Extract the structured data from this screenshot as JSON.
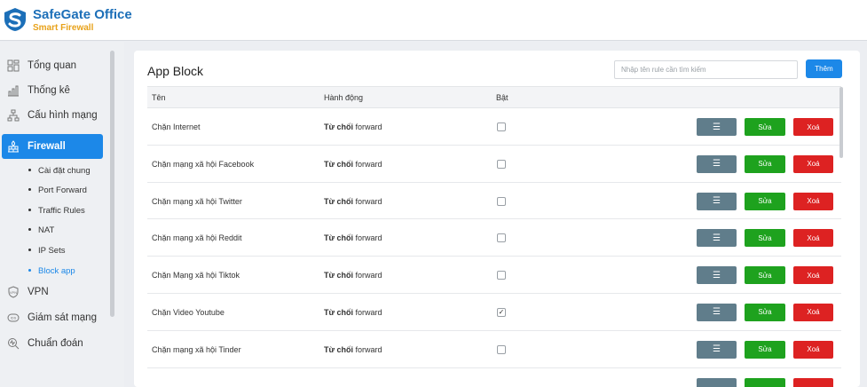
{
  "brand": {
    "title": "SafeGate Office",
    "subtitle": "Smart Firewall"
  },
  "sidebar": {
    "items": [
      {
        "label": "Tổng quan",
        "icon": "dashboard-icon"
      },
      {
        "label": "Thống kê",
        "icon": "chart-icon"
      },
      {
        "label": "Cấu hình mạng",
        "icon": "network-icon"
      },
      {
        "label": "Firewall",
        "icon": "firewall-icon",
        "active": true
      },
      {
        "label": "VPN",
        "icon": "vpn-shield-icon"
      },
      {
        "label": "Giám sát mạng",
        "icon": "ids-icon"
      },
      {
        "label": "Chuẩn đoán",
        "icon": "diagnostics-icon"
      }
    ],
    "subitems": [
      {
        "label": "Cài đặt chung"
      },
      {
        "label": "Port Forward"
      },
      {
        "label": "Traffic Rules"
      },
      {
        "label": "NAT"
      },
      {
        "label": "IP Sets"
      },
      {
        "label": "Block app",
        "active": true
      }
    ]
  },
  "main": {
    "title": "App Block",
    "search_placeholder": "Nhập tên rule cần tìm kiếm",
    "add_label": "Thêm",
    "columns": [
      "Tên",
      "Hành động",
      "Bật"
    ],
    "rows": [
      {
        "name": "Chặn Internet",
        "action_bold": "Từ chối",
        "action_rest": " forward",
        "enabled": false
      },
      {
        "name": "Chặn mạng xã hội Facebook",
        "action_bold": "Từ chối",
        "action_rest": " forward",
        "enabled": false
      },
      {
        "name": "Chặn mạng xã hội Twitter",
        "action_bold": "Từ chối",
        "action_rest": " forward",
        "enabled": false
      },
      {
        "name": "Chặn mạng xã hội Reddit",
        "action_bold": "Từ chối",
        "action_rest": " forward",
        "enabled": false
      },
      {
        "name": "Chặn Mạng xã hội Tiktok",
        "action_bold": "Từ chối",
        "action_rest": " forward",
        "enabled": false
      },
      {
        "name": "Chặn Video Youtube",
        "action_bold": "Từ chối",
        "action_rest": " forward",
        "enabled": true
      },
      {
        "name": "Chặn mạng xã hội Tinder",
        "action_bold": "Từ chối",
        "action_rest": " forward",
        "enabled": false
      }
    ],
    "row_buttons": {
      "menu": "☰",
      "edit": "Sửa",
      "delete": "Xoá"
    }
  },
  "colors": {
    "primary": "#1c88e8",
    "brand_blue": "#1c6fb8",
    "brand_orange": "#e8a21a",
    "edit": "#1ea21e",
    "delete": "#dd2222",
    "menu": "#607d8b"
  }
}
